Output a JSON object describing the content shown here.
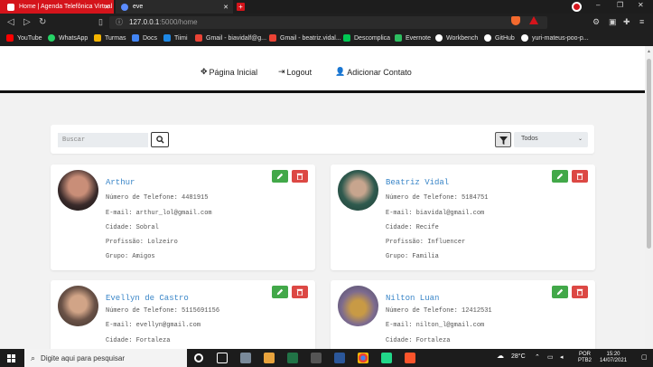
{
  "browser": {
    "tabs": [
      {
        "label": "Home | Agenda Telefônica Virtual",
        "close": "✕"
      },
      {
        "label": "eve",
        "close": "✕"
      }
    ],
    "new_tab": "+",
    "address": {
      "host": "127.0.0.1",
      "rest": ":5000/home"
    },
    "bookmarks": [
      {
        "label": "YouTube",
        "color": "#ff0000"
      },
      {
        "label": "WhatsApp",
        "color": "#25d366"
      },
      {
        "label": "Turmas",
        "color": "#f4b400"
      },
      {
        "label": "Docs",
        "color": "#4285f4"
      },
      {
        "label": "Tiimi",
        "color": "#1e88e5"
      },
      {
        "label": "Gmail - biavidalf@g...",
        "color": "#ea4335"
      },
      {
        "label": "Gmail - beatriz.vidal...",
        "color": "#ea4335"
      },
      {
        "label": "Descomplica",
        "color": "#00c853"
      },
      {
        "label": "Evernote",
        "color": "#2dbe60"
      },
      {
        "label": "Workbench",
        "color": "#ffffff"
      },
      {
        "label": "GitHub",
        "color": "#ffffff"
      },
      {
        "label": "yuri-mateus-poo-p...",
        "color": "#ffffff"
      }
    ]
  },
  "nav": {
    "home": "Página Inicial",
    "logout": "Logout",
    "add_contact": "Adicionar Contato"
  },
  "filters": {
    "search_placeholder": "Buscar",
    "group_selected": "Todos"
  },
  "contacts": [
    {
      "name": "Arthur",
      "phone": "Número de Telefone: 4481915",
      "email": "E-mail: arthur_lol@gmail.com",
      "city": "Cidade: Sobral",
      "profession": "Profissão: Lolzeiro",
      "group": "Grupo: Amigos"
    },
    {
      "name": "Beatriz Vidal",
      "phone": "Número de Telefone: 5184751",
      "email": "E-mail: biavidal@gmail.com",
      "city": "Cidade: Recife",
      "profession": "Profissão: Influencer",
      "group": "Grupo: Familia"
    },
    {
      "name": "Evellyn de Castro",
      "phone": "Número de Telefone: 5115691156",
      "email": "E-mail: evellyn@gmail.com",
      "city": "Cidade: Fortaleza"
    },
    {
      "name": "Nilton Luan",
      "phone": "Número de Telefone: 12412531",
      "email": "E-mail: nilton_l@gmail.com",
      "city": "Cidade: Fortaleza"
    }
  ],
  "taskbar": {
    "search_placeholder": "Digite aqui para pesquisar",
    "weather": "28°C",
    "lang_top": "POR",
    "lang_bottom": "PTB2",
    "time": "15:20",
    "date": "14/07/2021"
  },
  "colors": {
    "accent_red": "#d4141b",
    "edit_green": "#42a849",
    "delete_red": "#dc4844",
    "name_blue": "#3a86c8"
  }
}
